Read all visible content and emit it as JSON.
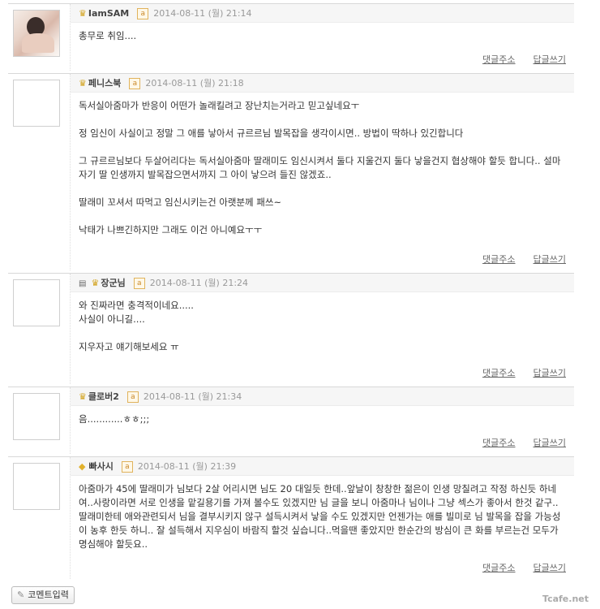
{
  "comments": [
    {
      "author": "IamSAM",
      "badge": "crown",
      "datetime": "2014-08-11 (월) 21:14",
      "lines": [
        "총무로 취임...."
      ],
      "actions": {
        "reply_link": "댓글주소",
        "write_reply": "답글쓰기"
      }
    },
    {
      "author": "페니스북",
      "badge": "crown",
      "datetime": "2014-08-11 (월) 21:18",
      "lines": [
        "독서실아줌마가 반응이 어떤가 놀래킬려고 장난치는거라고 믿고싶네요ㅜ",
        "",
        "정 임신이 사실이고 정말 그 애를 낳아서 규르르님 발목잡을 생각이시면.. 방법이 딱하나 있긴합니다",
        "",
        "그 규르르님보다 두살어리다는 독서실아줌마 딸래미도 임신시켜서 둘다 지울건지 둘다 낳을건지 협상해야 할듯 합니다.. 설마 자기 딸 인생까지 발목잡으면서까지 그 아이 낳으려 들진 않겠죠..",
        "",
        "딸래미 꼬셔서 따먹고 임신시키는건 아랫분께 패쓰~",
        "",
        "낙태가 나쁘긴하지만 그래도 이건 아니예요ㅜㅜ"
      ],
      "actions": {
        "reply_link": "댓글주소",
        "write_reply": "답글쓰기"
      }
    },
    {
      "author": "장군님",
      "badge": "crown",
      "memo_icon": "memo-icon",
      "datetime": "2014-08-11 (월) 21:24",
      "lines": [
        "와 진짜라면 충격적이네요.....",
        "사실이 아니길....",
        "",
        "지우자고 얘기해보세요 ㅠ"
      ],
      "actions": {
        "reply_link": "댓글주소",
        "write_reply": "답글쓰기"
      }
    },
    {
      "author": "클로버2",
      "badge": "crown",
      "datetime": "2014-08-11 (월) 21:34",
      "lines": [
        "음............ㅎㅎ;;;"
      ],
      "actions": {
        "reply_link": "댓글주소",
        "write_reply": "답글쓰기"
      }
    },
    {
      "author": "빠사시",
      "badge": "diamond",
      "datetime": "2014-08-11 (월) 21:39",
      "lines": [
        "아줌마가 45에 딸래미가 님보다 2살 어리시면 님도 20 대일듯 한데..앞날이 창창한 젊은이 인생 망칠려고 작정 하신듯 하네여..사랑이라면 서로 인생을 맡길용기를 가져 볼수도 있겠지만 님 글을 보니 아줌마나 님이나 그냥 섹스가 좋아서 한것 같구..딸래미한테 애와관련되서 님을 결부시키지 않구 설득시켜서 낳을 수도 있겠지만 언젠가는 애를 빌미로 님 발목을 잡을 가능성이 농후 한듯 하니.. 잘 설득해서 지우심이 바람직 할것 싶습니다..먹을땐 좋았지만 한순간의 방심이 큰 화를 부르는건 모두가 명심해야 할듯요.."
      ],
      "actions": {
        "reply_link": "댓글주소",
        "write_reply": "답글쓰기"
      }
    }
  ],
  "comment_input_button": "코멘트입력",
  "watermark": "Tcafe.net",
  "level_badge_text": "a"
}
